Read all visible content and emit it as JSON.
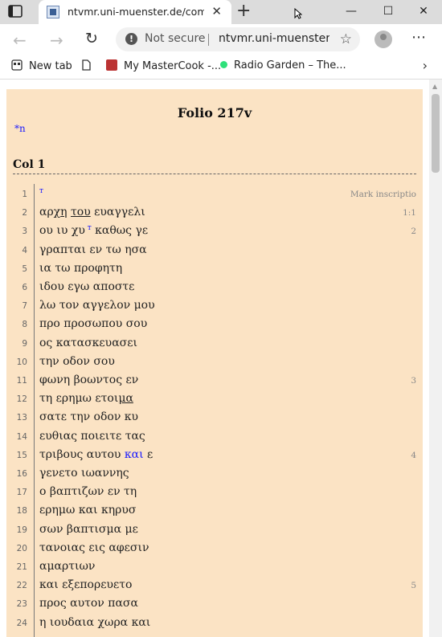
{
  "browser": {
    "tab_title": "ntvmr.uni-muenster.de/commun",
    "not_secure_label": "Not secure",
    "url": "ntvmr.uni-muenster.de/community",
    "bookmarks": [
      {
        "label": "New tab"
      },
      {
        "label": ""
      },
      {
        "label": "My MasterCook -..."
      },
      {
        "label": "Radio Garden – The..."
      }
    ]
  },
  "document": {
    "folio_title": "Folio 217v",
    "note": "*n",
    "column_heading": "Col 1",
    "lines": [
      {
        "n": "1",
        "text": "",
        "sup": "т",
        "ref": "Mark inscriptio"
      },
      {
        "n": "2",
        "text": "",
        "ref": "1:1"
      },
      {
        "n": "3",
        "text": "ου ιυ χυ",
        "sup": "т",
        "text2": " καθως γε",
        "ref": "2"
      },
      {
        "n": "4",
        "text": "γραπται εν τω ησα",
        "ref": ""
      },
      {
        "n": "5",
        "text": "ια τω προφητη",
        "ref": ""
      },
      {
        "n": "6",
        "text": "ιδου εγω αποστε",
        "ref": ""
      },
      {
        "n": "7",
        "text": "λω τον αγγελον μου",
        "ref": ""
      },
      {
        "n": "8",
        "text": "προ προσωπου σου",
        "ref": ""
      },
      {
        "n": "9",
        "text": "ος κατασκευασει",
        "ref": ""
      },
      {
        "n": "10",
        "text": "την οδον σου",
        "ref": ""
      },
      {
        "n": "11",
        "text": "φωνη βοωντος εν",
        "ref": "3"
      },
      {
        "n": "12",
        "text": "τη ερημω ετοι",
        "ul": "μα",
        "ref": ""
      },
      {
        "n": "13",
        "text": "σατε την οδον κυ",
        "ref": ""
      },
      {
        "n": "14",
        "text": "ευθιας ποιειτε τας",
        "ref": ""
      },
      {
        "n": "15",
        "text": "τριβους αυτου ",
        "blue": "και",
        "text2": " ε",
        "ref": "4"
      },
      {
        "n": "16",
        "text": "γενετο ιωαννης",
        "ref": ""
      },
      {
        "n": "17",
        "text": "ο βαπτιζων εν τη",
        "ref": ""
      },
      {
        "n": "18",
        "text": "ερημω και κηρυσ",
        "ref": ""
      },
      {
        "n": "19",
        "text": "σων βαπτισμα με",
        "ref": ""
      },
      {
        "n": "20",
        "text": "τανοιας εις αφεσιν",
        "ref": ""
      },
      {
        "n": "21",
        "text": "αμαρτιων",
        "ref": ""
      },
      {
        "n": "22",
        "text": "και εξεπορευετο",
        "ref": "5"
      },
      {
        "n": "23",
        "text": "προς αυτον πασα",
        "ref": ""
      },
      {
        "n": "24",
        "text": "η ιουδαια χωρα και",
        "ref": ""
      }
    ],
    "line2_parts": [
      "αρχ",
      "η",
      " ",
      "του",
      " ευαγγελι"
    ]
  }
}
